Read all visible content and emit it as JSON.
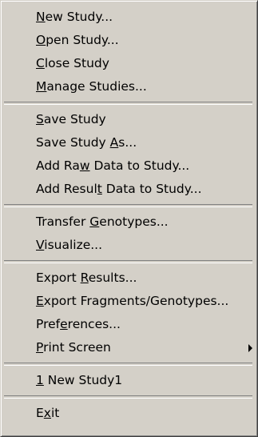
{
  "menu": {
    "groups": [
      [
        {
          "text": "New Study...",
          "mnemonic_index": 0
        },
        {
          "text": "Open Study...",
          "mnemonic_index": 0
        },
        {
          "text": "Close Study",
          "mnemonic_index": 0
        },
        {
          "text": "Manage Studies...",
          "mnemonic_index": 0
        }
      ],
      [
        {
          "text": "Save Study",
          "mnemonic_index": 0
        },
        {
          "text": "Save Study As...",
          "mnemonic_index": 11
        },
        {
          "text": "Add Raw Data to Study...",
          "mnemonic_index": 6
        },
        {
          "text": "Add Result Data to Study...",
          "mnemonic_index": 9
        }
      ],
      [
        {
          "text": "Transfer Genotypes...",
          "mnemonic_index": 9
        },
        {
          "text": "Visualize...",
          "mnemonic_index": 0
        }
      ],
      [
        {
          "text": "Export Results...",
          "mnemonic_index": 7
        },
        {
          "text": "Export Fragments/Genotypes...",
          "mnemonic_index": 0
        },
        {
          "text": "Preferences...",
          "mnemonic_index": 4
        },
        {
          "text": "Print Screen",
          "mnemonic_index": 0,
          "submenu": true,
          "submenu_icon": "triangle-right-icon"
        }
      ],
      [
        {
          "text": "1 New Study1",
          "mnemonic_index": 0
        }
      ],
      [
        {
          "text": "Exit",
          "mnemonic_index": 1
        }
      ]
    ]
  }
}
